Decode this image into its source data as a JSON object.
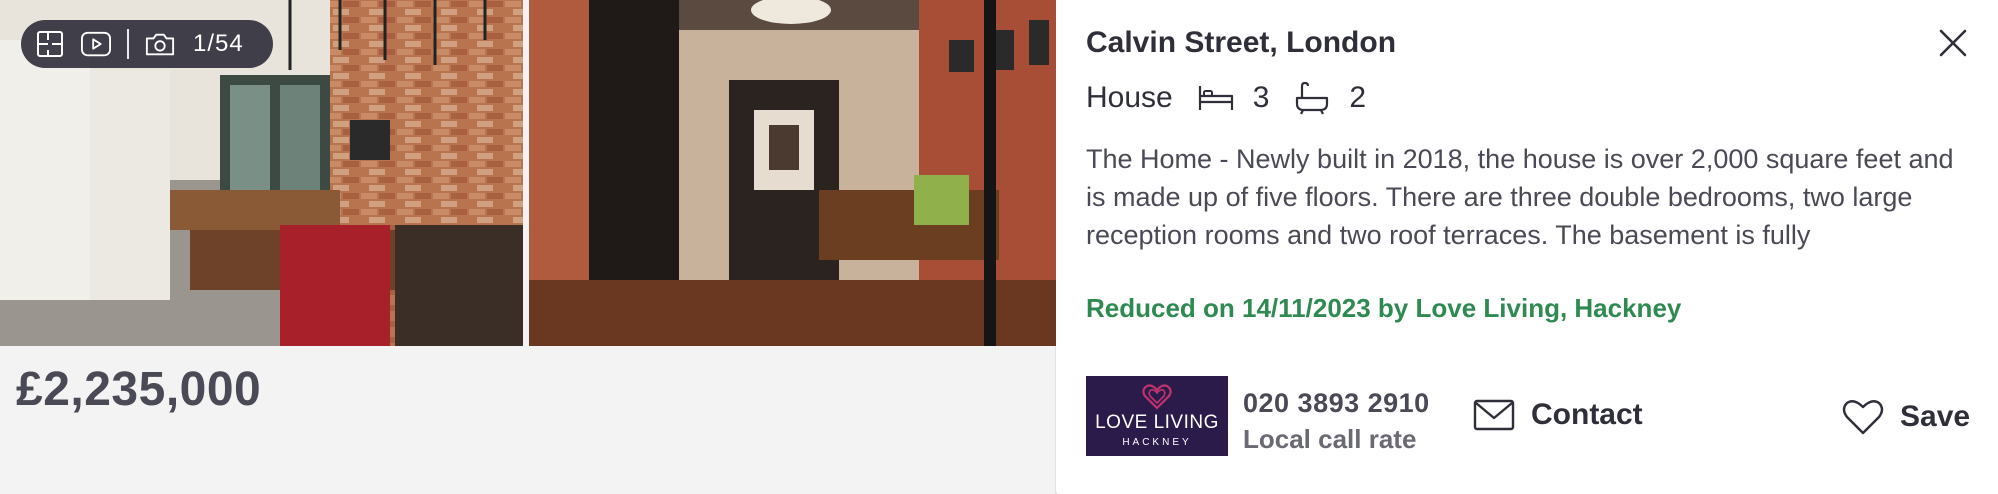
{
  "gallery": {
    "photo_count": "1/54",
    "photo_1_alt": "kitchen-dining",
    "photo_2_alt": "hallway-study",
    "icons": [
      "floorplan-icon",
      "video-icon",
      "camera-icon"
    ]
  },
  "listing": {
    "price": "£2,235,000",
    "title": "Calvin Street, London",
    "property_type": "House",
    "bedrooms": "3",
    "bathrooms": "2",
    "description": "The Home - Newly built in 2018, the house is over 2,000 square feet and is made up of five floors. There are three double bedrooms, two large reception rooms and two roof terraces. The basement is fully",
    "reduced_note": "Reduced on 14/11/2023 by Love Living, Hackney"
  },
  "agent": {
    "logo_line1": "LOVE LIVING",
    "logo_line2": "HACKNEY",
    "phone": "020 3893 2910",
    "call_rate": "Local call rate"
  },
  "actions": {
    "contact_label": "Contact",
    "save_label": "Save"
  },
  "colors": {
    "accent_green": "#2f8a52",
    "agent_logo_bg": "#2b1b4a",
    "heart_pink": "#c2336e"
  }
}
